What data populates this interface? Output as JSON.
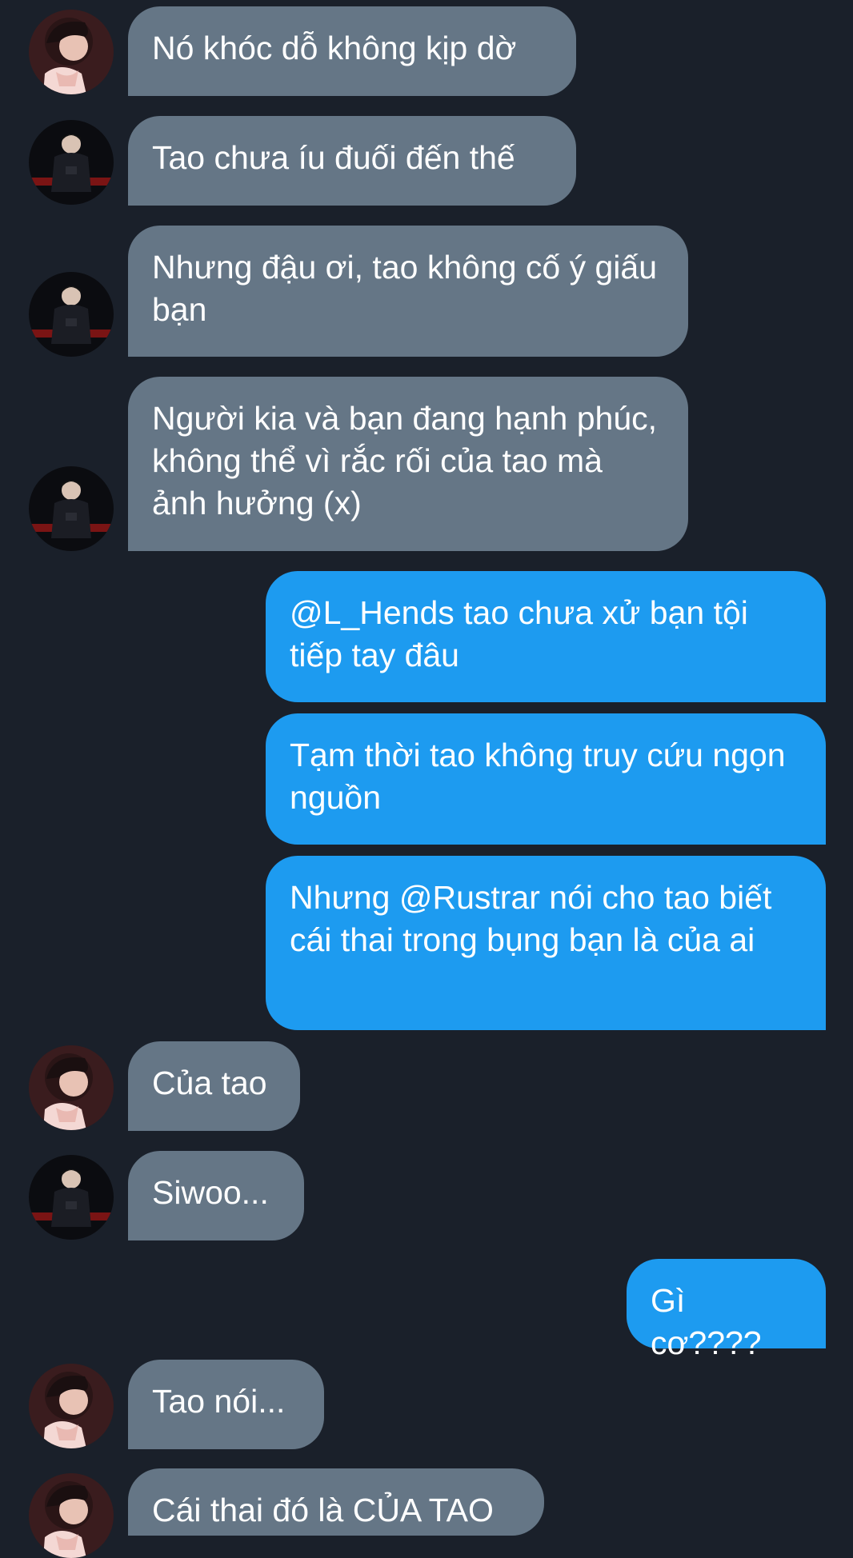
{
  "messages": [
    {
      "direction": "incoming",
      "sender": "A",
      "text": "Nó khóc dỗ không kịp dờ"
    },
    {
      "direction": "incoming",
      "sender": "B",
      "text": "Tao chưa íu đuối đến thế"
    },
    {
      "direction": "incoming",
      "sender": "B",
      "text": "Nhưng đậu ơi, tao không cố ý giấu bạn"
    },
    {
      "direction": "incoming",
      "sender": "B",
      "text": "Người kia và bạn đang hạnh phúc, không thể vì rắc rối của tao mà ảnh hưởng (x)"
    },
    {
      "direction": "outgoing",
      "text": "@L_Hends tao chưa xử bạn tội tiếp tay đâu"
    },
    {
      "direction": "outgoing",
      "text": "Tạm thời tao không truy cứu ngọn nguồn"
    },
    {
      "direction": "outgoing",
      "text": "Nhưng @Rustrar nói cho tao biết cái thai trong bụng bạn là của ai"
    },
    {
      "direction": "incoming",
      "sender": "A",
      "text": "Của tao"
    },
    {
      "direction": "incoming",
      "sender": "B",
      "text": "Siwoo..."
    },
    {
      "direction": "outgoing",
      "text": "Gì cơ????"
    },
    {
      "direction": "incoming",
      "sender": "A",
      "text": "Tao nói..."
    },
    {
      "direction": "incoming",
      "sender": "A",
      "text": "Cái thai đó là CỦA TAO"
    }
  ],
  "colors": {
    "background": "#1a202a",
    "incoming_bubble": "#657686",
    "outgoing_bubble": "#1d9bf0",
    "text": "#ffffff"
  },
  "avatars": {
    "A": "avatar-person-pink-scarf-icon",
    "B": "avatar-person-dark-outfit-icon"
  }
}
